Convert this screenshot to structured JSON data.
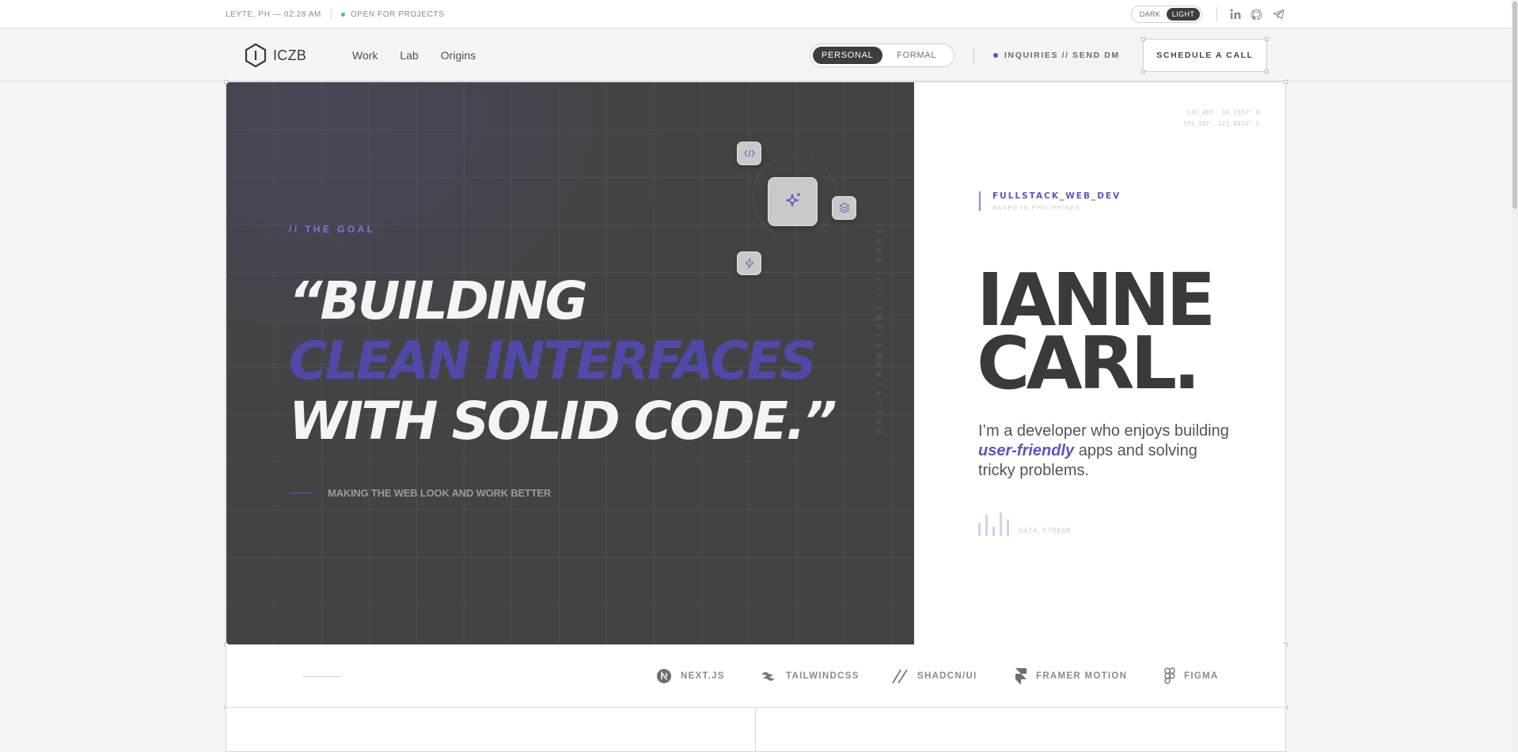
{
  "topbar": {
    "location": "LEYTE, PH — 02:28 AM",
    "status": "OPEN FOR PROJECTS",
    "theme_dark": "DARK",
    "theme_light": "LIGHT",
    "social": [
      "linkedin-icon",
      "github-icon",
      "telegram-icon"
    ]
  },
  "nav": {
    "brand": "ICZB",
    "links": [
      "Work",
      "Lab",
      "Origins"
    ],
    "mode_personal": "PERSONAL",
    "mode_formal": "FORMAL",
    "inquiry": "INQUIRIES // SEND DM",
    "cta": "SCHEDULE A CALL"
  },
  "hero": {
    "goal_label": "// THE GOAL",
    "quote_line1": "“BUILDING",
    "quote_line2": "CLEAN INTERFACES",
    "quote_line3": "WITH SOLID CODE.”",
    "tagline": "MAKING THE WEB LOOK AND WORK BETTER",
    "vertical_text": "CODE // IMPLEMENTATION",
    "coords_1": "LOC_REF: 10.3157° N",
    "coords_2": "SYS_REF: 123.8854° E",
    "role": "FULLSTACK_WEB_DEV",
    "based": "BASED IN PHILIPPINES",
    "name_line1": "IANNE",
    "name_line2": "CARL.",
    "bio_1": "I’m a developer who enjoys building ",
    "bio_em": "user-friendly",
    "bio_2": " apps and solving tricky problems.",
    "stream_label": "DATA_STREAM",
    "stream_levels": [
      0.55,
      0.9,
      0.4,
      1.0,
      0.7
    ],
    "accent_color": "#5a54c9"
  },
  "tech": {
    "items": [
      "NEXT.JS",
      "TAILWINDCSS",
      "SHADCN/UI",
      "FRAMER MOTION",
      "FIGMA"
    ]
  }
}
